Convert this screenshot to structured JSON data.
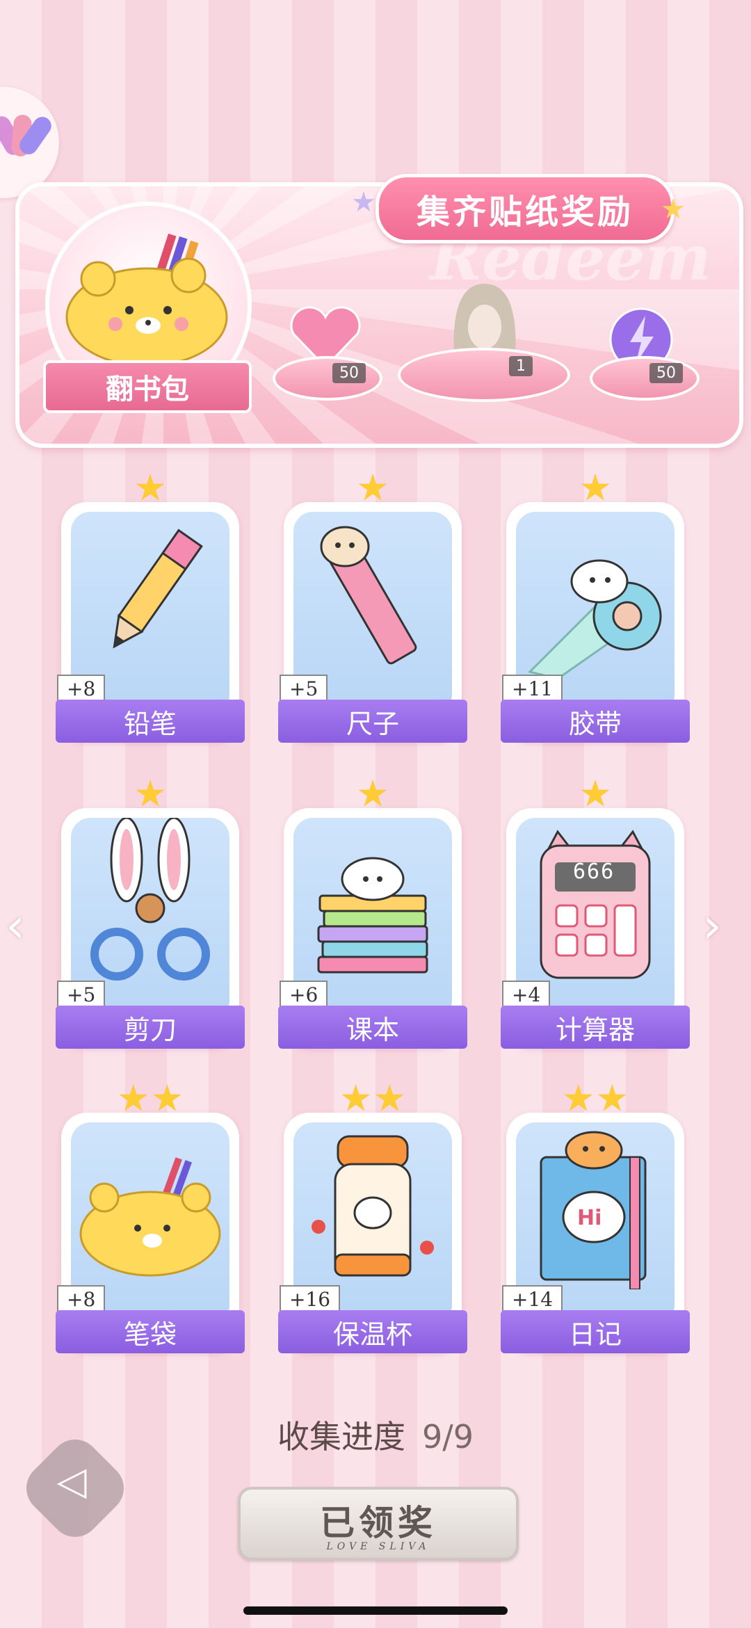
{
  "banner": {
    "title": "集齐贴纸奖励",
    "watermark": "Redeem",
    "bag_label": "翻书包",
    "rewards": [
      {
        "icon": "pink-heart-gem-icon",
        "qty": "50"
      },
      {
        "icon": "avatar-hair-icon",
        "qty": "1"
      },
      {
        "icon": "purple-lightning-orb-icon",
        "qty": "50"
      }
    ]
  },
  "stickers": [
    {
      "name": "铅笔",
      "bonus": "+8",
      "stars": 1,
      "icon": "pencil-icon"
    },
    {
      "name": "尺子",
      "bonus": "+5",
      "stars": 1,
      "icon": "ruler-icon"
    },
    {
      "name": "胶带",
      "bonus": "+11",
      "stars": 1,
      "icon": "tape-icon"
    },
    {
      "name": "剪刀",
      "bonus": "+5",
      "stars": 1,
      "icon": "scissors-icon"
    },
    {
      "name": "课本",
      "bonus": "+6",
      "stars": 1,
      "icon": "textbook-icon"
    },
    {
      "name": "计算器",
      "bonus": "+4",
      "stars": 1,
      "icon": "calculator-icon",
      "screen": "666"
    },
    {
      "name": "笔袋",
      "bonus": "+8",
      "stars": 2,
      "icon": "pencil-case-icon"
    },
    {
      "name": "保温杯",
      "bonus": "+16",
      "stars": 2,
      "icon": "thermos-icon"
    },
    {
      "name": "日记",
      "bonus": "+14",
      "stars": 2,
      "icon": "diary-icon",
      "cover_text": "Hi"
    }
  ],
  "progress": {
    "label": "收集进度",
    "value": "9/9"
  },
  "claim_button": {
    "label": "已领奖",
    "subtitle": "LOVE SLIVA"
  },
  "colors": {
    "label_purple": "#9a6ee8",
    "banner_pink": "#f28aa8",
    "card_blue": "#c4ddf8"
  }
}
